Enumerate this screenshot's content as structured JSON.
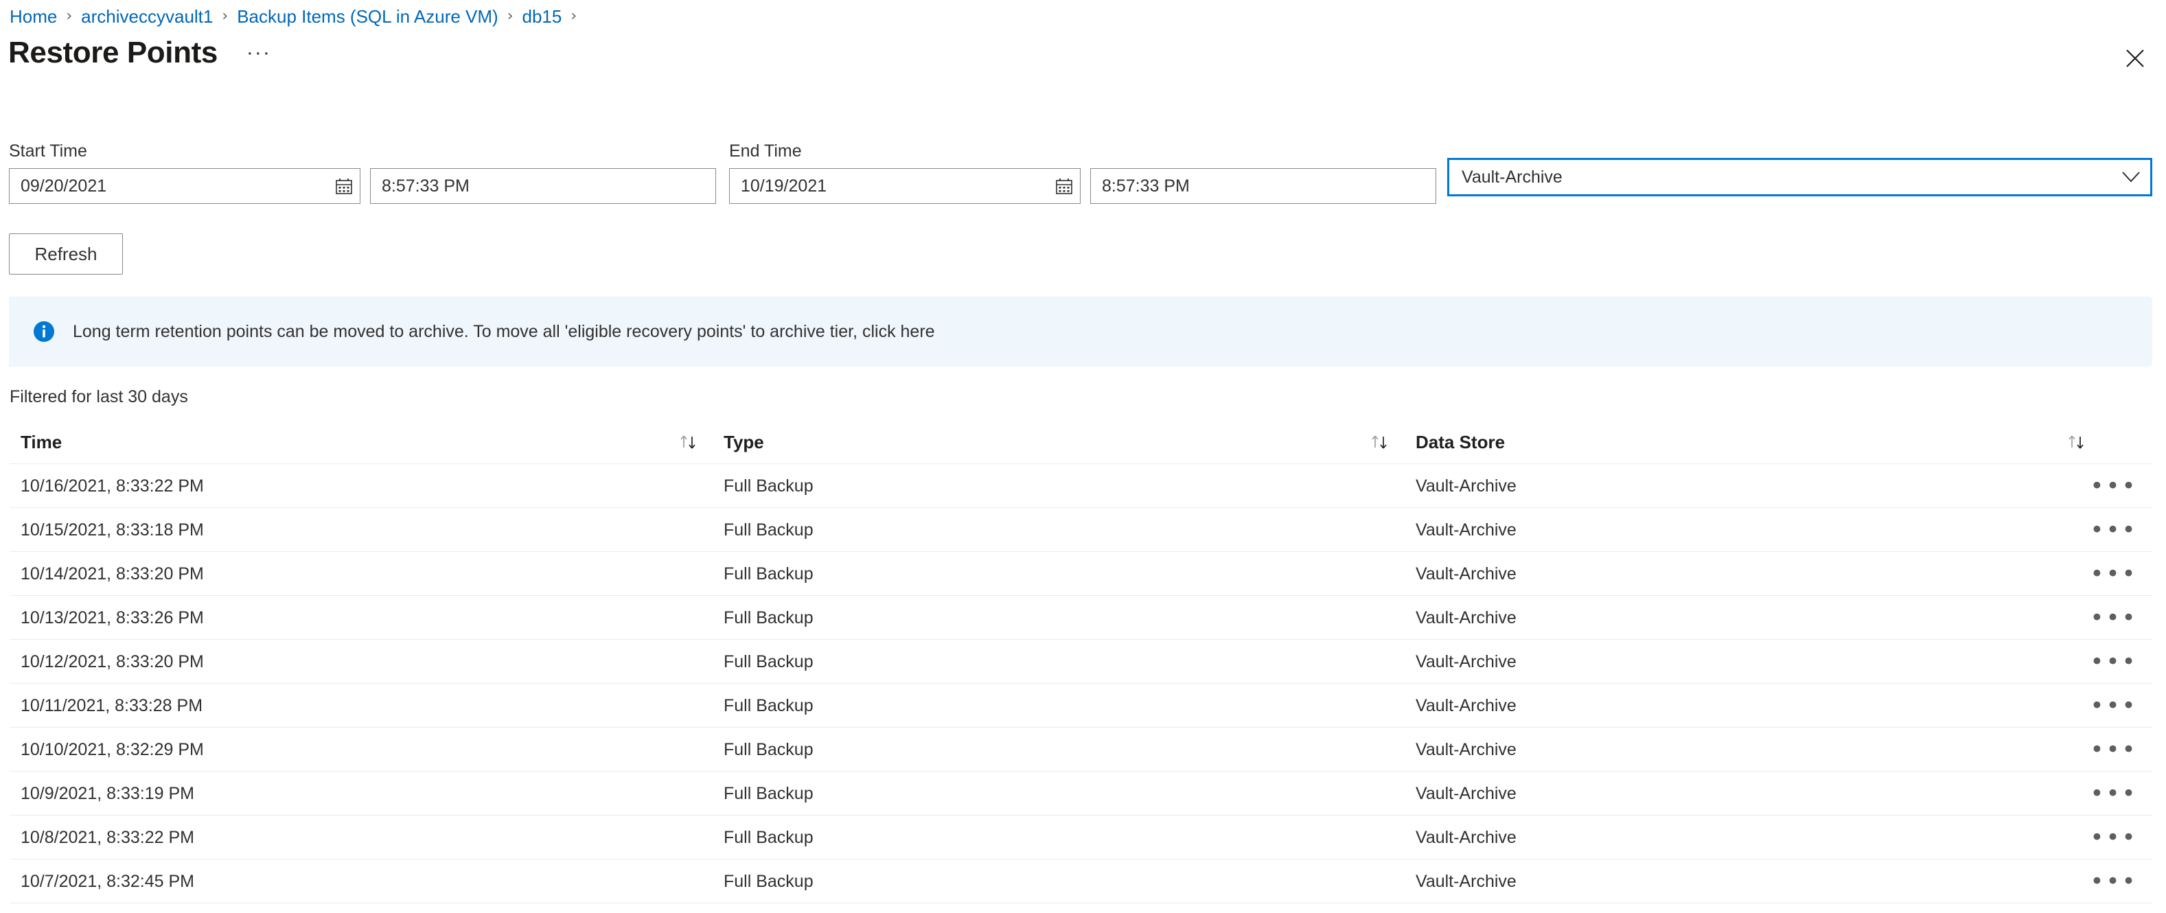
{
  "breadcrumb": {
    "separator": "›",
    "items": [
      {
        "label": "Home"
      },
      {
        "label": "archiveccyvault1"
      },
      {
        "label": "Backup Items (SQL in Azure VM)"
      },
      {
        "label": "db15"
      }
    ]
  },
  "header": {
    "title": "Restore Points",
    "more_label": "···",
    "close_icon": "close-icon"
  },
  "filters": {
    "start_time": {
      "label": "Start Time",
      "date_value": "09/20/2021",
      "date_placeholder": "mm/dd/yyyy",
      "time_value": "8:57:33 PM",
      "time_placeholder": "hh:mm:ss AM/PM",
      "calendar_icon": "calendar-icon"
    },
    "end_time": {
      "label": "End Time",
      "date_value": "10/19/2021",
      "date_placeholder": "mm/dd/yyyy",
      "time_value": "8:57:33 PM",
      "time_placeholder": "hh:mm:ss AM/PM",
      "calendar_icon": "calendar-icon"
    },
    "data_store": {
      "selected": "Vault-Archive",
      "chevron_icon": "chevron-down-icon",
      "focus_border_color": "#0078d4"
    },
    "refresh_label": "Refresh"
  },
  "banner": {
    "icon": "info-icon",
    "icon_color": "#0078d4",
    "background_color": "#eff6fc",
    "text": "Long term retention points can be moved to archive. To move all 'eligible recovery points' to archive tier, click here"
  },
  "table": {
    "filtered_note": "Filtered for last 30 days",
    "columns": [
      {
        "label": "Time",
        "sort_icon": "sort-icon"
      },
      {
        "label": "Type",
        "sort_icon": "sort-icon"
      },
      {
        "label": "Data Store",
        "sort_icon": "sort-icon"
      }
    ],
    "trailing_sort_icon": "sort-icon",
    "row_menu_icon": "ellipsis-icon",
    "rows": [
      {
        "time": "10/16/2021, 8:33:22 PM",
        "type": "Full Backup",
        "data_store": "Vault-Archive"
      },
      {
        "time": "10/15/2021, 8:33:18 PM",
        "type": "Full Backup",
        "data_store": "Vault-Archive"
      },
      {
        "time": "10/14/2021, 8:33:20 PM",
        "type": "Full Backup",
        "data_store": "Vault-Archive"
      },
      {
        "time": "10/13/2021, 8:33:26 PM",
        "type": "Full Backup",
        "data_store": "Vault-Archive"
      },
      {
        "time": "10/12/2021, 8:33:20 PM",
        "type": "Full Backup",
        "data_store": "Vault-Archive"
      },
      {
        "time": "10/11/2021, 8:33:28 PM",
        "type": "Full Backup",
        "data_store": "Vault-Archive"
      },
      {
        "time": "10/10/2021, 8:32:29 PM",
        "type": "Full Backup",
        "data_store": "Vault-Archive"
      },
      {
        "time": "10/9/2021, 8:33:19 PM",
        "type": "Full Backup",
        "data_store": "Vault-Archive"
      },
      {
        "time": "10/8/2021, 8:33:22 PM",
        "type": "Full Backup",
        "data_store": "Vault-Archive"
      },
      {
        "time": "10/7/2021, 8:32:45 PM",
        "type": "Full Backup",
        "data_store": "Vault-Archive"
      }
    ]
  }
}
